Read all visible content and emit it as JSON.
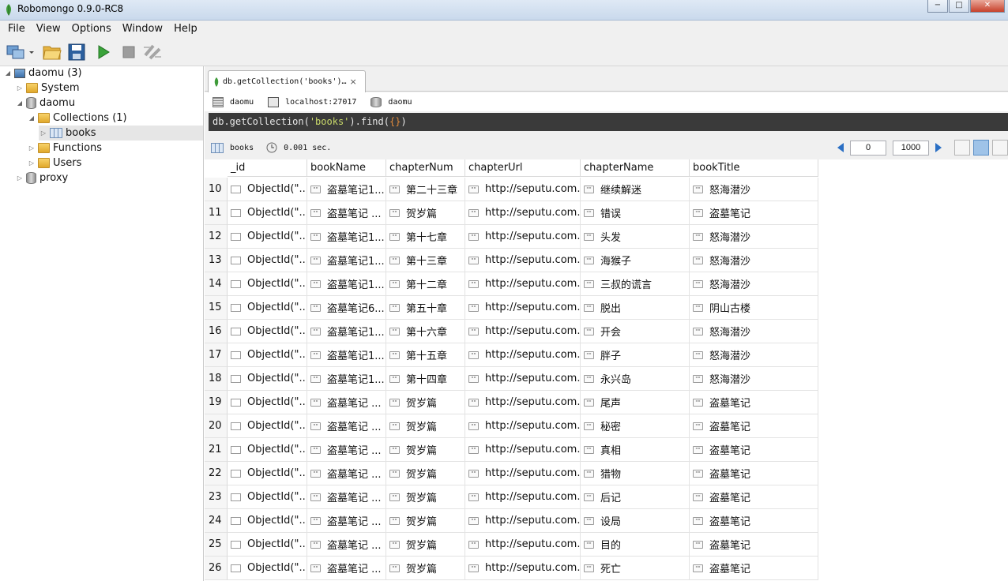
{
  "window": {
    "title": "Robomongo 0.9.0-RC8",
    "buttons": [
      "−",
      "□",
      "✕"
    ]
  },
  "menu": [
    "File",
    "View",
    "Options",
    "Window",
    "Help"
  ],
  "tree": [
    {
      "label": "daomu (3)",
      "icon": "computer-icon",
      "arrow": "◢"
    },
    {
      "label": "System",
      "icon": "folder-icon",
      "arrow": "▷"
    },
    {
      "label": "daomu",
      "icon": "database-icon",
      "arrow": "◢"
    },
    {
      "label": "Collections (1)",
      "icon": "folder-icon",
      "arrow": "◢"
    },
    {
      "label": "books",
      "icon": "collection-icon",
      "arrow": "▷",
      "selected": true
    },
    {
      "label": "Functions",
      "icon": "folder-icon",
      "arrow": "▷"
    },
    {
      "label": "Users",
      "icon": "folder-icon",
      "arrow": "▷"
    },
    {
      "label": "proxy",
      "icon": "database-icon",
      "arrow": "▷"
    }
  ],
  "tab": {
    "label": "db.getCollection('books')…",
    "close": "×"
  },
  "connection": {
    "server": "daomu",
    "host": "localhost:27017",
    "db": "daomu"
  },
  "query": {
    "prefix": "db.getCollection(",
    "arg": "'books'",
    "suffix": ").find(",
    "braces": "{}",
    "end": ")"
  },
  "result": {
    "collection": "books",
    "time": "0.001 sec.",
    "skip": "0",
    "limit": "1000"
  },
  "columns": [
    "_id",
    "bookName",
    "chapterNum",
    "chapterUrl",
    "chapterName",
    "bookTitle"
  ],
  "rows": [
    {
      "n": "10",
      "id": "ObjectId(\"...",
      "book": "盗墓笔记1...",
      "num": "第二十三章",
      "url": "http://seputu.com...",
      "name": "继续解迷",
      "title": "怒海潜沙"
    },
    {
      "n": "11",
      "id": "ObjectId(\"...",
      "book": "盗墓笔记 ...",
      "num": "贺岁篇",
      "url": "http://seputu.com...",
      "name": "错误",
      "title": "盗墓笔记"
    },
    {
      "n": "12",
      "id": "ObjectId(\"...",
      "book": "盗墓笔记1...",
      "num": "第十七章",
      "url": "http://seputu.com...",
      "name": "头发",
      "title": "怒海潜沙"
    },
    {
      "n": "13",
      "id": "ObjectId(\"...",
      "book": "盗墓笔记1...",
      "num": "第十三章",
      "url": "http://seputu.com...",
      "name": "海猴子",
      "title": "怒海潜沙"
    },
    {
      "n": "14",
      "id": "ObjectId(\"...",
      "book": "盗墓笔记1...",
      "num": "第十二章",
      "url": "http://seputu.com...",
      "name": "三叔的谎言",
      "title": "怒海潜沙"
    },
    {
      "n": "15",
      "id": "ObjectId(\"...",
      "book": "盗墓笔记6...",
      "num": "第五十章",
      "url": "http://seputu.com...",
      "name": "脱出",
      "title": "阴山古楼"
    },
    {
      "n": "16",
      "id": "ObjectId(\"...",
      "book": "盗墓笔记1...",
      "num": "第十六章",
      "url": "http://seputu.com...",
      "name": "开会",
      "title": "怒海潜沙"
    },
    {
      "n": "17",
      "id": "ObjectId(\"...",
      "book": "盗墓笔记1...",
      "num": "第十五章",
      "url": "http://seputu.com...",
      "name": "胖子",
      "title": "怒海潜沙"
    },
    {
      "n": "18",
      "id": "ObjectId(\"...",
      "book": "盗墓笔记1...",
      "num": "第十四章",
      "url": "http://seputu.com...",
      "name": "永兴岛",
      "title": "怒海潜沙"
    },
    {
      "n": "19",
      "id": "ObjectId(\"...",
      "book": "盗墓笔记 ...",
      "num": "贺岁篇",
      "url": "http://seputu.com...",
      "name": "尾声",
      "title": "盗墓笔记"
    },
    {
      "n": "20",
      "id": "ObjectId(\"...",
      "book": "盗墓笔记 ...",
      "num": "贺岁篇",
      "url": "http://seputu.com...",
      "name": "秘密",
      "title": "盗墓笔记"
    },
    {
      "n": "21",
      "id": "ObjectId(\"...",
      "book": "盗墓笔记 ...",
      "num": "贺岁篇",
      "url": "http://seputu.com...",
      "name": "真相",
      "title": "盗墓笔记"
    },
    {
      "n": "22",
      "id": "ObjectId(\"...",
      "book": "盗墓笔记 ...",
      "num": "贺岁篇",
      "url": "http://seputu.com...",
      "name": "猎物",
      "title": "盗墓笔记"
    },
    {
      "n": "23",
      "id": "ObjectId(\"...",
      "book": "盗墓笔记 ...",
      "num": "贺岁篇",
      "url": "http://seputu.com...",
      "name": "后记",
      "title": "盗墓笔记"
    },
    {
      "n": "24",
      "id": "ObjectId(\"...",
      "book": "盗墓笔记 ...",
      "num": "贺岁篇",
      "url": "http://seputu.com...",
      "name": "设局",
      "title": "盗墓笔记"
    },
    {
      "n": "25",
      "id": "ObjectId(\"...",
      "book": "盗墓笔记 ...",
      "num": "贺岁篇",
      "url": "http://seputu.com...",
      "name": "目的",
      "title": "盗墓笔记"
    },
    {
      "n": "26",
      "id": "ObjectId(\"...",
      "book": "盗墓笔记 ...",
      "num": "贺岁篇",
      "url": "http://seputu.com...",
      "name": "死亡",
      "title": "盗墓笔记"
    }
  ],
  "string_icon": "\"\""
}
